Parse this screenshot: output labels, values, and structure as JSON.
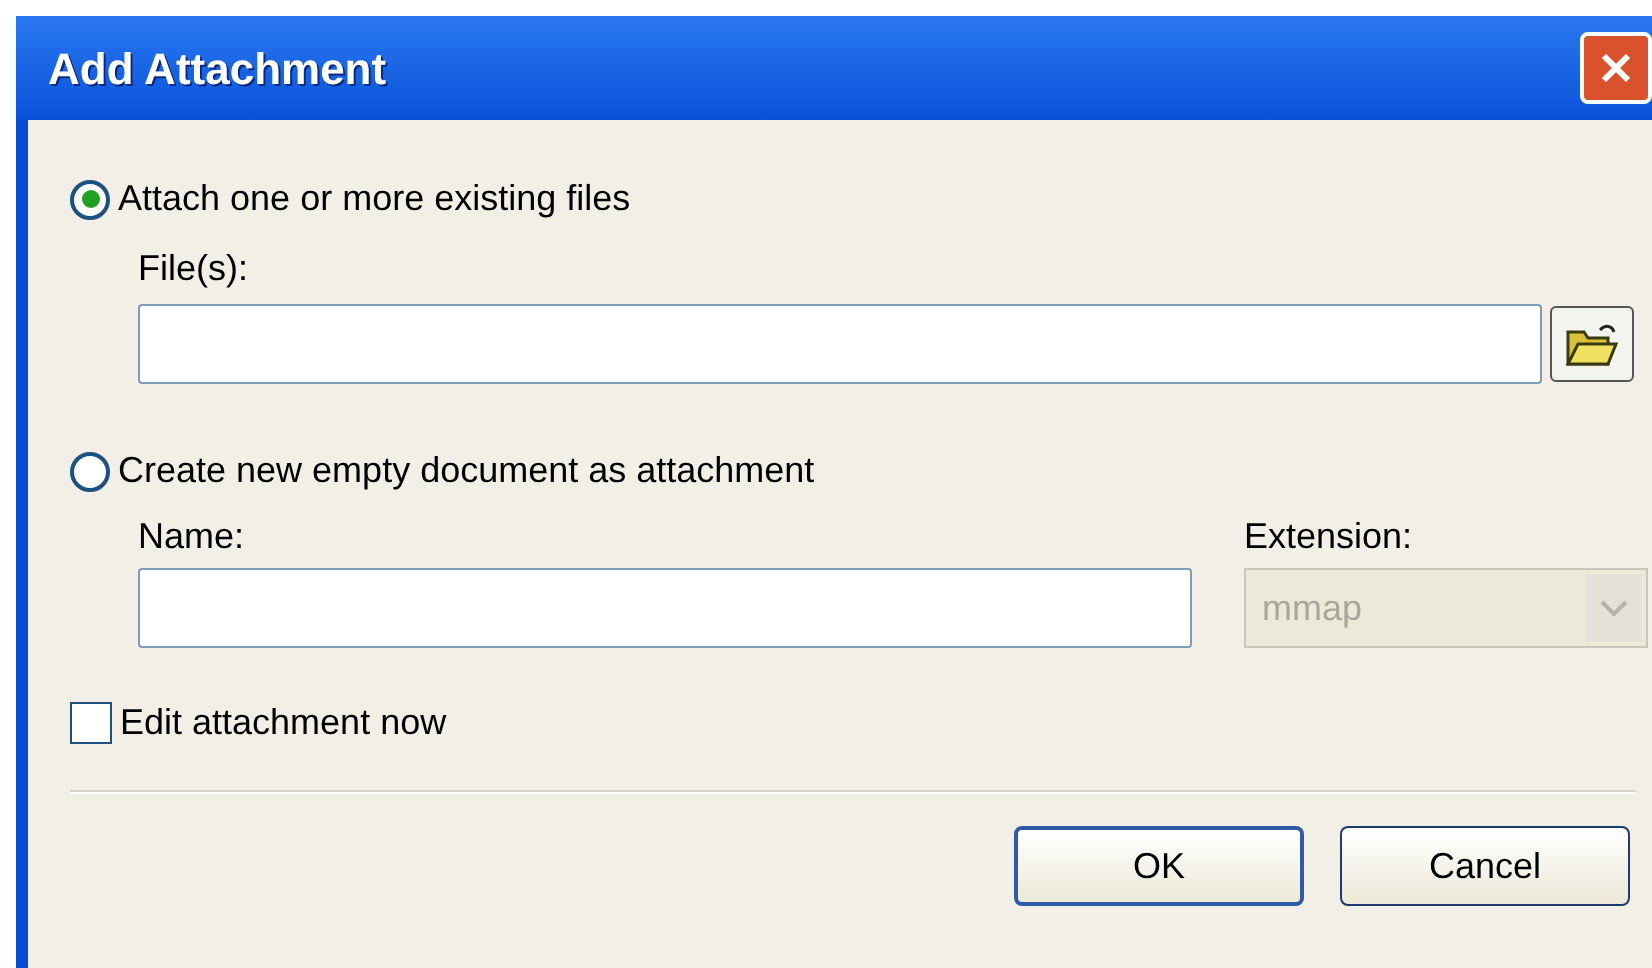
{
  "window": {
    "title": "Add Attachment"
  },
  "options": [
    {
      "label": "Attach one or more existing files",
      "selected": true,
      "field_label": "File(s):"
    },
    {
      "label": "Create new empty document as attachment",
      "selected": false,
      "field_label": "Name:"
    }
  ],
  "extension": {
    "label": "Extension:",
    "value": "mmap",
    "disabled": true
  },
  "edit_now": {
    "label": "Edit attachment now",
    "checked": false
  },
  "buttons": [
    {
      "label": "OK",
      "default": true
    },
    {
      "label": "Cancel",
      "default": false
    }
  ]
}
